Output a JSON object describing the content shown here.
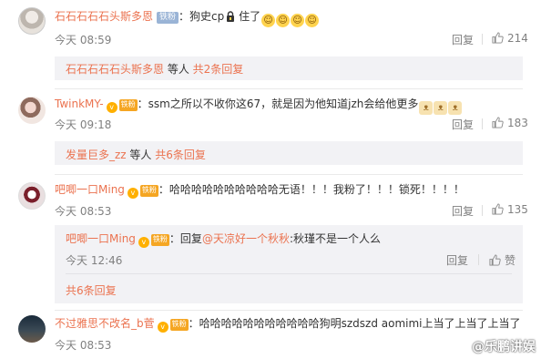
{
  "comments": [
    {
      "username": "石石石石石头斯多恩",
      "badge": "铁粉",
      "text_before": "狗史cp",
      "text_after": " 住了",
      "emoji_count": 4,
      "time": "今天 08:59",
      "reply_label": "回复",
      "likes": "214",
      "more_users": "石石石石石头斯多恩",
      "more_mid": " 等人 ",
      "more_count": "共2条回复"
    },
    {
      "username": "TwinkMY-",
      "badge": "铁粉",
      "text": "：ssm之所以不收你这67，就是因为他知道jzh会给他更多",
      "time": "今天 09:18",
      "reply_label": "回复",
      "likes": "183",
      "more_users": "发量巨多_zz",
      "more_mid": " 等人 ",
      "more_count": "共6条回复"
    },
    {
      "username": "吧唧一口Ming",
      "badge": "铁粉",
      "text": "：哈哈哈哈哈哈哈哈哈哈无语！！！我粉了！！！锁死！！！！",
      "time": "今天 08:53",
      "reply_label": "回复",
      "likes": "135",
      "sub_reply": {
        "username": "吧唧一口Ming",
        "badge": "铁粉",
        "prefix": "：回复",
        "mention": "@天凉好一个秋秋",
        "text": ":秋瑾不是一个人么",
        "time": "今天 12:46",
        "reply_label": "回复",
        "like_label": "赞"
      },
      "more_count": "共6条回复"
    },
    {
      "username": "不过雅思不改名_b菅",
      "badge": "铁粉",
      "text": "：哈哈哈哈哈哈哈哈哈哈哈狗明szdszd aomimi上当了上当了上当了",
      "time": "今天 08:53",
      "reply_label": "回复"
    }
  ],
  "watermark": "@乐鹏讲娱",
  "icons": {
    "thumb": "thumbs-up-icon",
    "lock": "lock-emoji-icon",
    "laugh": "laughing-emoji-icon",
    "dog": "doge-emoji-icon",
    "vip": "vip-badge-icon"
  },
  "colors": {
    "username": "#eb7350",
    "badge_fan": "#9ab4d6",
    "badge_orange": "#f5a623",
    "meta": "#808080",
    "subbox_bg": "#f2f2f5"
  }
}
